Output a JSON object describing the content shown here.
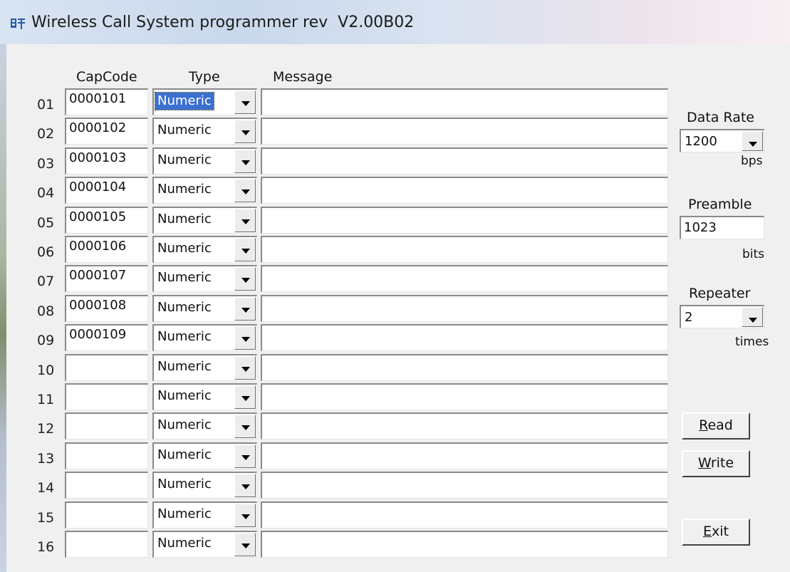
{
  "window": {
    "title": "Wireless Call System programmer rev  V2.00B02",
    "icon": "app-icon"
  },
  "headers": {
    "capcode": "CapCode",
    "type": "Type",
    "message": "Message"
  },
  "rows": [
    {
      "num": "01",
      "capcode": "0000101",
      "type": "Numeric",
      "message": ""
    },
    {
      "num": "02",
      "capcode": "0000102",
      "type": "Numeric",
      "message": ""
    },
    {
      "num": "03",
      "capcode": "0000103",
      "type": "Numeric",
      "message": ""
    },
    {
      "num": "04",
      "capcode": "0000104",
      "type": "Numeric",
      "message": ""
    },
    {
      "num": "05",
      "capcode": "0000105",
      "type": "Numeric",
      "message": ""
    },
    {
      "num": "06",
      "capcode": "0000106",
      "type": "Numeric",
      "message": ""
    },
    {
      "num": "07",
      "capcode": "0000107",
      "type": "Numeric",
      "message": ""
    },
    {
      "num": "08",
      "capcode": "0000108",
      "type": "Numeric",
      "message": ""
    },
    {
      "num": "09",
      "capcode": "0000109",
      "type": "Numeric",
      "message": ""
    },
    {
      "num": "10",
      "capcode": "",
      "type": "Numeric",
      "message": ""
    },
    {
      "num": "11",
      "capcode": "",
      "type": "Numeric",
      "message": ""
    },
    {
      "num": "12",
      "capcode": "",
      "type": "Numeric",
      "message": ""
    },
    {
      "num": "13",
      "capcode": "",
      "type": "Numeric",
      "message": ""
    },
    {
      "num": "14",
      "capcode": "",
      "type": "Numeric",
      "message": ""
    },
    {
      "num": "15",
      "capcode": "",
      "type": "Numeric",
      "message": ""
    },
    {
      "num": "16",
      "capcode": "",
      "type": "Numeric",
      "message": ""
    }
  ],
  "settings": {
    "data_rate": {
      "label": "Data Rate",
      "value": "1200",
      "unit": "bps"
    },
    "preamble": {
      "label": "Preamble",
      "value": "1023",
      "unit": "bits"
    },
    "repeater": {
      "label": "Repeater",
      "value": "2",
      "unit": "times"
    }
  },
  "buttons": {
    "read": {
      "accel": "R",
      "rest": "ead"
    },
    "write": {
      "accel": "W",
      "rest": "rite"
    },
    "exit": {
      "accel": "E",
      "rest": "xit"
    }
  },
  "colors": {
    "selection": "#3a70d0",
    "face": "#f0f0f0"
  }
}
